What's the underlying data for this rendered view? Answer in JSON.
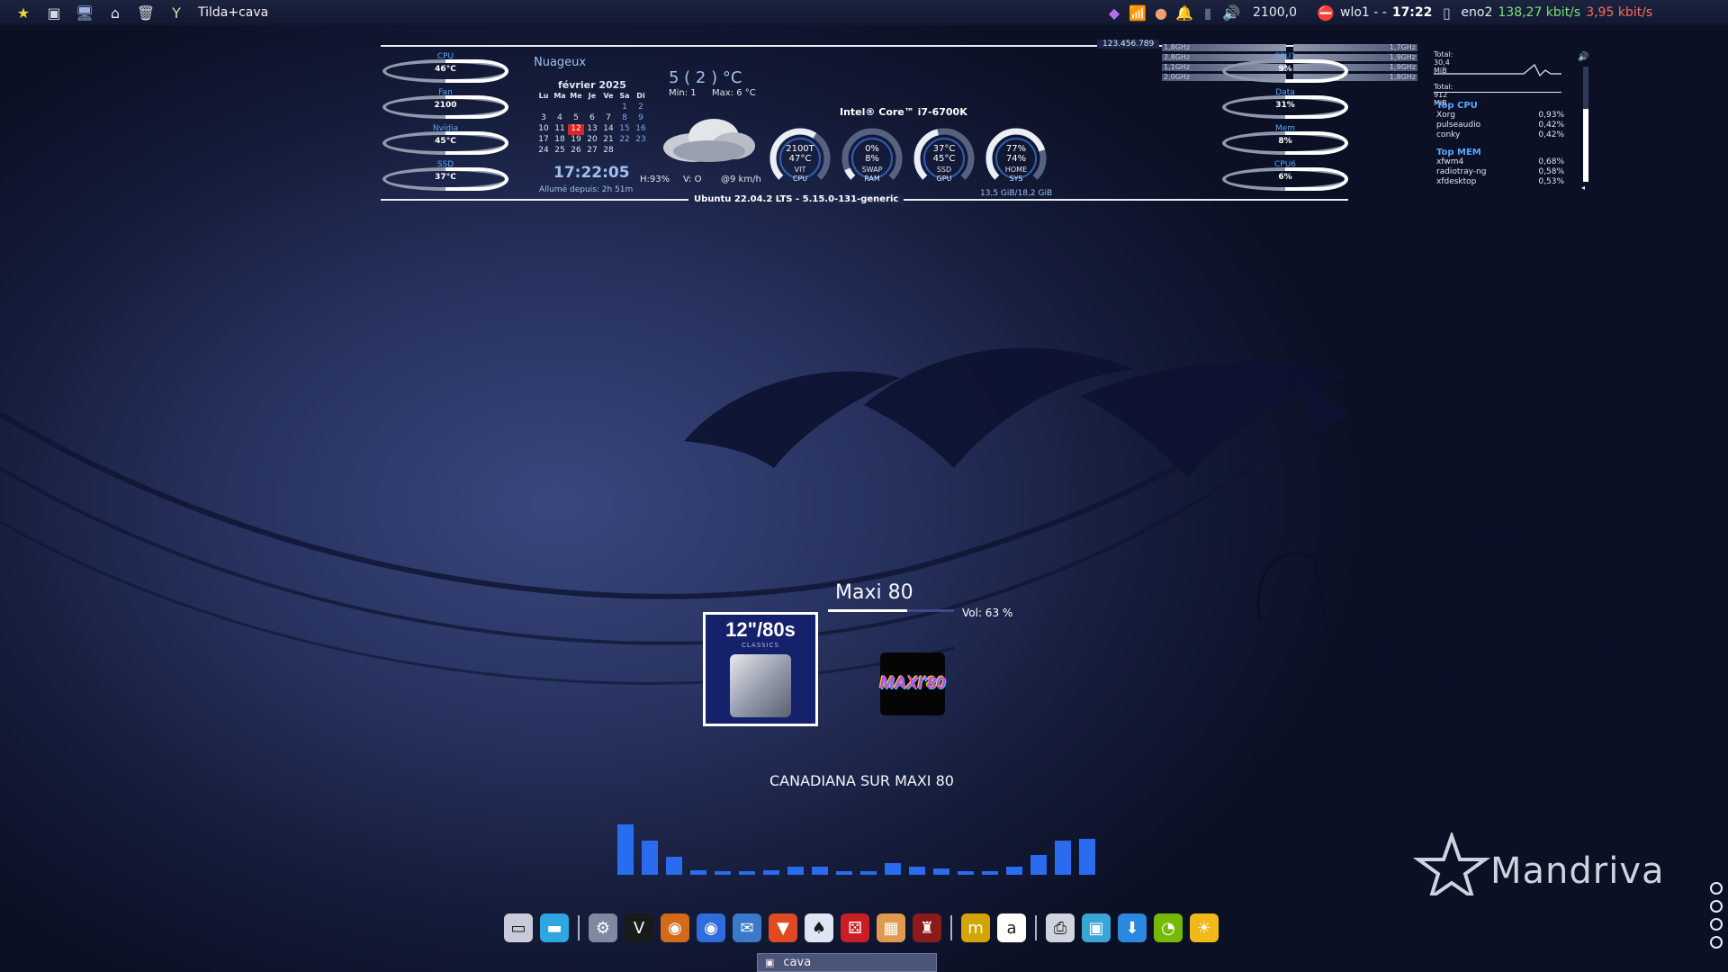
{
  "top_panel": {
    "launcher_icons": [
      "mandriva-star-icon",
      "terminal-icon",
      "monitor-icon",
      "home-folder-icon",
      "trash-icon",
      "tilda-icon"
    ],
    "window_title": "Tilda+cava",
    "tray": {
      "value": "2100,0",
      "network_if": "wlo1 - -",
      "clock": "17:22",
      "wired_if": "eno2",
      "down_rate": "138,27 kbit/s",
      "up_rate": "3,95 kbit/s"
    }
  },
  "conky": {
    "left_rings": [
      {
        "label": "CPU",
        "value": "46°C"
      },
      {
        "label": "Fan",
        "value": "2100"
      },
      {
        "label": "Nvidia",
        "value": "45°C"
      },
      {
        "label": "SSD",
        "value": "37°C"
      }
    ],
    "right_rings": [
      {
        "label": "CPU1",
        "value": "9%"
      },
      {
        "label": "Data",
        "value": "31%"
      },
      {
        "label": "Mem",
        "value": "8%"
      },
      {
        "label": "CPU6",
        "value": "6%"
      }
    ],
    "top_number": "123.456.789",
    "weather": {
      "condition": "Nuageux",
      "temp": "5   ( 2 ) °C",
      "min": "Min:  1",
      "max": "Max: 6  °C",
      "humidity": "H:93%",
      "wind_dir": "V: O",
      "wind_speed": "@9 km/h"
    },
    "calendar": {
      "month": "février 2025",
      "days": [
        "Lu",
        "Ma",
        "Me",
        "Je",
        "Ve",
        "Sa",
        "Di"
      ],
      "weeks": [
        [
          "",
          "",
          "",
          "",
          "",
          "1",
          "2"
        ],
        [
          "3",
          "4",
          "5",
          "6",
          "7",
          "8",
          "9"
        ],
        [
          "10",
          "11",
          "12",
          "13",
          "14",
          "15",
          "16"
        ],
        [
          "17",
          "18",
          "19",
          "20",
          "21",
          "22",
          "23"
        ],
        [
          "24",
          "25",
          "26",
          "27",
          "28",
          "",
          ""
        ]
      ],
      "today": "12"
    },
    "clock": "17:22:05",
    "uptime": "Allumé depuis: 2h 51m",
    "cpu_freqs": [
      [
        "1,8GHz",
        "1,7GHz"
      ],
      [
        "2,8GHz",
        "1,9GHz"
      ],
      [
        "1,1GHz",
        "1,9GHz"
      ],
      [
        "2,0GHz",
        "1,8GHz"
      ]
    ],
    "cpu_model": "Intel® Core™ i7-6700K",
    "gauges": [
      {
        "top": "2100T",
        "mid": "47°C",
        "l1": "VIT",
        "l2": "CPU",
        "level": 0.62
      },
      {
        "top": "0%",
        "mid": "8%",
        "l1": "SWAP",
        "l2": "RAM",
        "level": 0.08
      },
      {
        "top": "37°C",
        "mid": "45°C",
        "l1": "SSD",
        "l2": "GPU",
        "level": 0.45
      },
      {
        "top": "77%",
        "mid": "74%",
        "l1": "HOME",
        "l2": "SYS",
        "level": 0.77
      }
    ],
    "disk_summary": "13,5 GiB/18,2 GiB",
    "net_totals": {
      "up": "Total:   30,4 MiB",
      "down": "Total:    912 MiB"
    },
    "top_cpu": {
      "heading": "Top CPU",
      "rows": [
        [
          "Xorg",
          "0,93%"
        ],
        [
          "pulseaudio",
          "0,42%"
        ],
        [
          "conky",
          "0,42%"
        ]
      ]
    },
    "top_mem": {
      "heading": "Top MEM",
      "rows": [
        [
          "xfwm4",
          "0,68%"
        ],
        [
          "radiotray-ng",
          "0,58%"
        ],
        [
          "xfdesktop",
          "0,53%"
        ]
      ]
    },
    "os_line": "Ubuntu 22.04.2 LTS - 5.15.0-131-generic"
  },
  "player": {
    "station": "Maxi 80",
    "volume_text": "Vol: 63 %",
    "volume_level": 0.63,
    "cover_title": "12\"/80s",
    "cover_sub": "CLASSICS",
    "station_logo": "MAXI'80",
    "track": "CANADIANA SUR MAXI 80"
  },
  "cava_levels": [
    0.62,
    0.42,
    0.22,
    0.06,
    0.04,
    0.04,
    0.06,
    0.1,
    0.1,
    0.04,
    0.04,
    0.14,
    0.1,
    0.08,
    0.04,
    0.04,
    0.1,
    0.24,
    0.42,
    0.44
  ],
  "dock": {
    "icons": [
      {
        "name": "desktop-icon",
        "color": "#c8ccd8"
      },
      {
        "name": "window-icon",
        "color": "#2ea6e0"
      },
      {
        "sep": true
      },
      {
        "name": "system-config-icon",
        "color": "#7f8aa0"
      },
      {
        "name": "vivaldi-icon",
        "color": "#1a1a1a"
      },
      {
        "name": "firefox-dev-icon",
        "color": "#d26a1a"
      },
      {
        "name": "firefox-icon",
        "color": "#2f6cdc"
      },
      {
        "name": "thunderbird-icon",
        "color": "#3a7ac8"
      },
      {
        "name": "brave-icon",
        "color": "#e04a22"
      },
      {
        "name": "cards-game-icon",
        "color": "#dde6f2"
      },
      {
        "name": "dice-icon",
        "color": "#c71f24"
      },
      {
        "name": "mahjong-icon",
        "color": "#e09a50"
      },
      {
        "name": "chess-icon",
        "color": "#8b1a1a"
      },
      {
        "sep": true
      },
      {
        "name": "mahjongg-m-icon",
        "color": "#d6a400"
      },
      {
        "name": "amazon-icon",
        "color": "#ffffff"
      },
      {
        "sep": true
      },
      {
        "name": "printer-icon",
        "color": "#d0d4de"
      },
      {
        "name": "remote-desktop-icon",
        "color": "#3aa6d8"
      },
      {
        "name": "download-icon",
        "color": "#2a88e0"
      },
      {
        "name": "nvidia-icon",
        "color": "#76b900"
      },
      {
        "name": "sun-icon",
        "color": "#f0b818"
      }
    ]
  },
  "taskbar": {
    "label": "cava"
  },
  "brand": {
    "name": "Mandriva"
  },
  "colors": {
    "accent": "#59a7ff",
    "cava": "#2a6cf0",
    "net_down": "#7ee07a",
    "net_up": "#ff6b5c"
  }
}
